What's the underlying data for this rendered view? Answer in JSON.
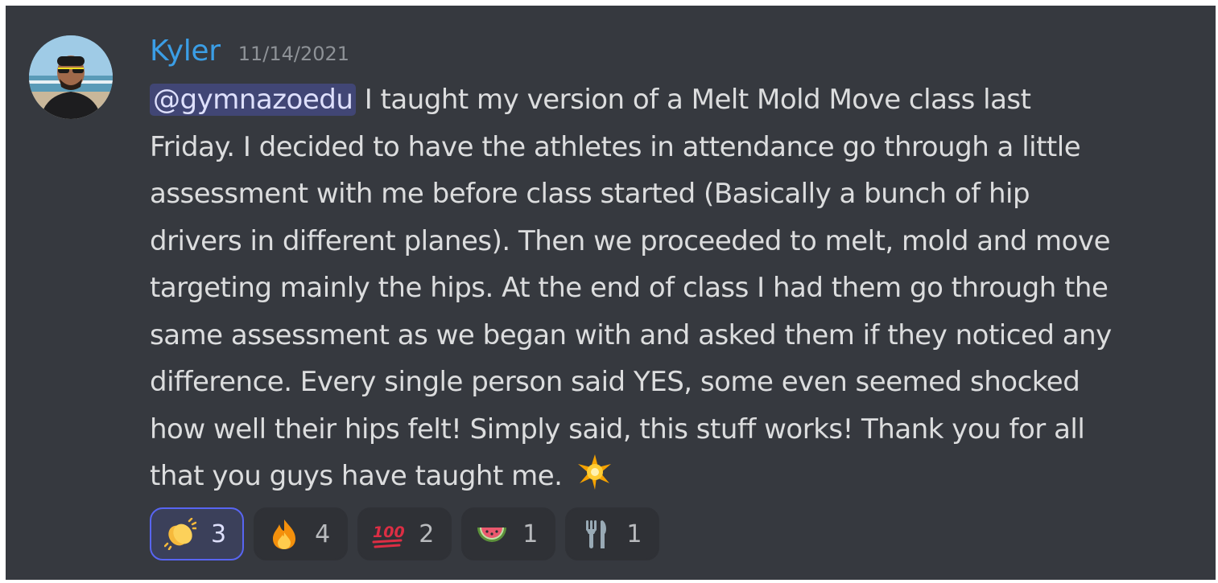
{
  "message": {
    "author": "Kyler",
    "timestamp": "11/14/2021",
    "mention": "@gymnazoedu",
    "lines": [
      " I taught my version of a Melt Mold Move class last",
      "Friday. I decided to have the athletes in attendance go through a little",
      "assessment with me before class started (Basically a bunch of hip",
      "drivers in different planes). Then we proceeded to melt, mold and move",
      "targeting mainly the hips. At the end of class I had them go through the",
      "same assessment as we began with and asked them if they noticed any",
      "difference. Every single person said YES, some even seemed shocked",
      "how well their hips felt! Simply said, this stuff works! Thank you for all",
      "that you guys have taught me. "
    ],
    "trailing_emoji": "sparkle-emoji"
  },
  "reactions": [
    {
      "emoji": "clapping-hands",
      "count": "3",
      "active": true
    },
    {
      "emoji": "fire",
      "count": "4",
      "active": false
    },
    {
      "emoji": "hundred-points",
      "count": "2",
      "active": false
    },
    {
      "emoji": "watermelon",
      "count": "1",
      "active": false
    },
    {
      "emoji": "fork-and-knife",
      "count": "1",
      "active": false
    }
  ],
  "colors": {
    "background": "#36393f",
    "username": "#3b9ee6",
    "text": "#dcddde",
    "mention_bg": "#414675",
    "reaction_active_border": "#5865f2"
  }
}
